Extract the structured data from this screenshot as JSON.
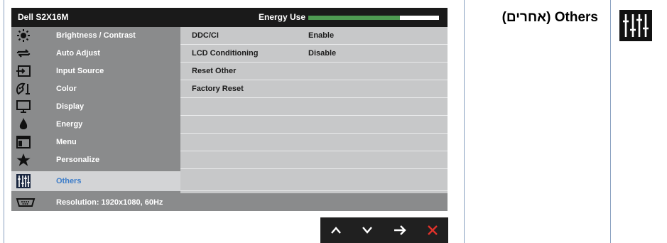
{
  "osd": {
    "model": "Dell S2X16M",
    "energy_label": "Energy Use",
    "energy_level_percent": 70,
    "menu": [
      {
        "label": "Brightness / Contrast",
        "icon": "brightness-icon"
      },
      {
        "label": "Auto Adjust",
        "icon": "auto-adjust-icon"
      },
      {
        "label": "Input Source",
        "icon": "input-source-icon"
      },
      {
        "label": "Color",
        "icon": "color-icon"
      },
      {
        "label": "Display",
        "icon": "display-icon"
      },
      {
        "label": "Energy",
        "icon": "energy-icon"
      },
      {
        "label": "Menu",
        "icon": "menu-icon"
      },
      {
        "label": "Personalize",
        "icon": "star-icon"
      },
      {
        "label": "Others",
        "icon": "sliders-icon",
        "selected": true
      }
    ],
    "status": {
      "label": "Resolution: 1920x1080, 60Hz",
      "icon": "connector-icon"
    },
    "submenu": [
      {
        "label": "DDC/CI",
        "value": "Enable"
      },
      {
        "label": "LCD Conditioning",
        "value": "Disable"
      },
      {
        "label": "Reset Other",
        "value": ""
      },
      {
        "label": "Factory Reset",
        "value": ""
      },
      {
        "label": "",
        "value": ""
      },
      {
        "label": "",
        "value": ""
      },
      {
        "label": "",
        "value": ""
      },
      {
        "label": "",
        "value": ""
      },
      {
        "label": "",
        "value": ""
      }
    ],
    "nav_buttons": [
      {
        "name": "up-arrow-icon",
        "glyph": "∧"
      },
      {
        "name": "down-arrow-icon",
        "glyph": "∨"
      },
      {
        "name": "right-arrow-icon",
        "glyph": "→"
      },
      {
        "name": "close-icon",
        "glyph": "✕"
      }
    ]
  },
  "heading": {
    "title": "Others (אחרים)",
    "icon": "sliders-icon"
  },
  "colors": {
    "accent_blue": "#3d7dc9",
    "energy_green": "#4e9a52",
    "close_red": "#e0322b",
    "frame_line": "#8aa1c0"
  }
}
